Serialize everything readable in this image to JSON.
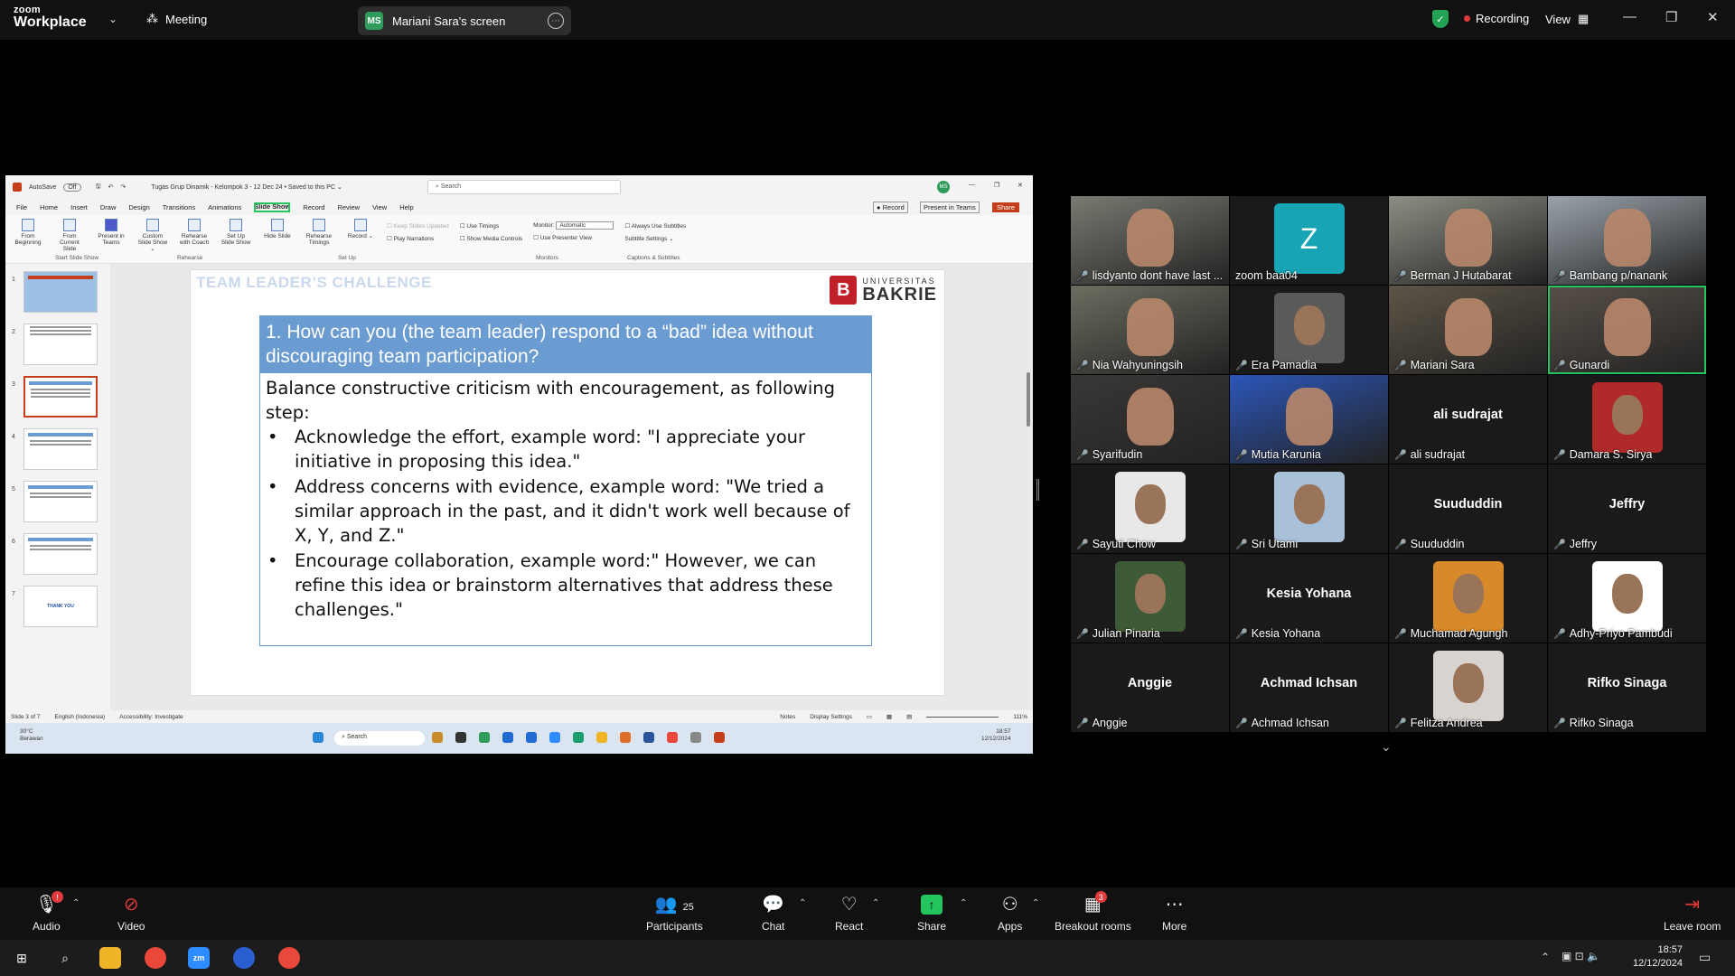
{
  "topbar": {
    "logo_line1": "zoom",
    "logo_line2": "Workplace",
    "meeting_label": "Meeting",
    "share_initials": "MS",
    "share_label": "Mariani Sara's screen",
    "recording_label": "Recording",
    "view_label": "View"
  },
  "ppt": {
    "autosave": "AutoSave",
    "autosave_state": "Off",
    "doc_title": "Tugas Grup Dinamik - Kelompok 3 - 12 Dec 24 • Saved to this PC ⌄",
    "search_placeholder": "Search",
    "user_initials": "MS",
    "menu": [
      "File",
      "Home",
      "Insert",
      "Draw",
      "Design",
      "Transitions",
      "Animations",
      "Slide Show",
      "Record",
      "Review",
      "View",
      "Help"
    ],
    "active_menu": "Slide Show",
    "record_btn": "Record",
    "present_teams_btn": "Present in Teams",
    "share_btn": "Share",
    "ribbon": {
      "from_beginning": "From Beginning",
      "from_current": "From Current Slide",
      "present_teams": "Present in Teams",
      "custom_show": "Custom Slide Show ⌄",
      "rehearse_coach": "Rehearse with Coach",
      "setup_show": "Set Up Slide Show",
      "hide_slide": "Hide Slide",
      "rehearse_timings": "Rehearse Timings",
      "record": "Record ⌄",
      "keep_updated": "Keep Slides Updated",
      "play_narrations": "Play Narrations",
      "use_timings": "Use Timings",
      "show_media": "Show Media Controls",
      "monitor_label": "Monitor:",
      "monitor_value": "Automatic",
      "presenter_view": "Use Presenter View",
      "always_subtitles": "Always Use Subtitles",
      "subtitle_settings": "Subtitle Settings ⌄",
      "grp_start": "Start Slide Show",
      "grp_rehearse": "Rehearse",
      "grp_setup": "Set Up",
      "grp_monitors": "Monitors",
      "grp_captions": "Captions & Subtitles"
    },
    "thumb_numbers": [
      "1",
      "2",
      "3",
      "4",
      "5",
      "6",
      "7"
    ],
    "thumb7_text": "THANK YOU",
    "slide": {
      "title": "TEAM LEADER’S CHALLENGE",
      "logo_top": "UNIVERSITAS",
      "logo_bottom": "BAKRIE",
      "logo_mark": "B",
      "question": "1. How can you (the team leader) respond to a “bad” idea without discouraging team participation?",
      "intro": "Balance constructive criticism with encouragement, as following step:",
      "bullets": [
        "Acknowledge the effort, example word: \"I appreciate your initiative in proposing this idea.\"",
        "Address concerns with evidence, example word: \"We tried a similar approach in the past, and it didn't work well because of X, Y, and Z.\"",
        "Encourage collaboration, example word:\" However, we can refine this idea or brainstorm alternatives that address these challenges.\""
      ]
    },
    "status": {
      "slide_of": "Slide 3 of 7",
      "language": "English (Indonesia)",
      "accessibility": "Accessibility: Investigate",
      "notes": "Notes",
      "display_settings": "Display Settings",
      "zoom": "111%"
    },
    "taskbar": {
      "weather_temp": "30°C",
      "weather_desc": "Berawan",
      "search": "Search",
      "time": "18:57",
      "date": "12/12/2024"
    }
  },
  "gallery": {
    "participants": [
      {
        "name": "lisdyanto dont have last ...",
        "kind": "video",
        "color": "#7a7a72"
      },
      {
        "name": "zoom baa04",
        "kind": "letter",
        "letter": "Z"
      },
      {
        "name": "Berman J Hutabarat",
        "kind": "video",
        "color": "#8d8f84"
      },
      {
        "name": "Bambang p/nanank",
        "kind": "video",
        "color": "#9aa3ab"
      },
      {
        "name": "Nia Wahyuningsih",
        "kind": "video",
        "color": "#6b6e60"
      },
      {
        "name": "Era Pamadia",
        "kind": "photo",
        "color": "#5a5a58"
      },
      {
        "name": "Mariani Sara",
        "kind": "video",
        "color": "#5d5547"
      },
      {
        "name": "Gunardi",
        "kind": "video",
        "color": "#585048",
        "active": true
      },
      {
        "name": "Syarifudin",
        "kind": "video",
        "color": "#3a3836"
      },
      {
        "name": "Mutia Karunia",
        "kind": "video",
        "color": "#2c56b8"
      },
      {
        "name": "ali sudrajat",
        "kind": "name"
      },
      {
        "name": "Damara S. Sirya",
        "kind": "photo",
        "color": "#b02a2a"
      },
      {
        "name": "Sayuti Chow",
        "kind": "photo",
        "color": "#e8e8e8"
      },
      {
        "name": "Sri Utami",
        "kind": "photo",
        "color": "#a8c0d8"
      },
      {
        "name": "Suududdin",
        "kind": "name"
      },
      {
        "name": "Jeffry",
        "kind": "name"
      },
      {
        "name": "Julian Pinaria",
        "kind": "photo",
        "color": "#3f5a36"
      },
      {
        "name": "Kesia Yohana",
        "kind": "name"
      },
      {
        "name": "Muchamad Agungh",
        "kind": "photo",
        "color": "#d88a2a"
      },
      {
        "name": "Adhy-Priyo Pambudi",
        "kind": "photo",
        "color": "#ffffff"
      },
      {
        "name": "Anggie",
        "kind": "name"
      },
      {
        "name": "Achmad Ichsan",
        "kind": "name"
      },
      {
        "name": "Felitza Andrea",
        "kind": "photo",
        "color": "#d9d3cf"
      },
      {
        "name": "Rifko Sinaga",
        "kind": "name"
      }
    ]
  },
  "toolbar": {
    "audio": "Audio",
    "audio_badge": "!",
    "video": "Video",
    "participants": "Participants",
    "participants_count": "25",
    "chat": "Chat",
    "react": "React",
    "share": "Share",
    "apps": "Apps",
    "breakout": "Breakout rooms",
    "breakout_badge": "3",
    "more": "More",
    "leave": "Leave room"
  },
  "windows": {
    "time": "18:57",
    "date": "12/12/2024"
  }
}
